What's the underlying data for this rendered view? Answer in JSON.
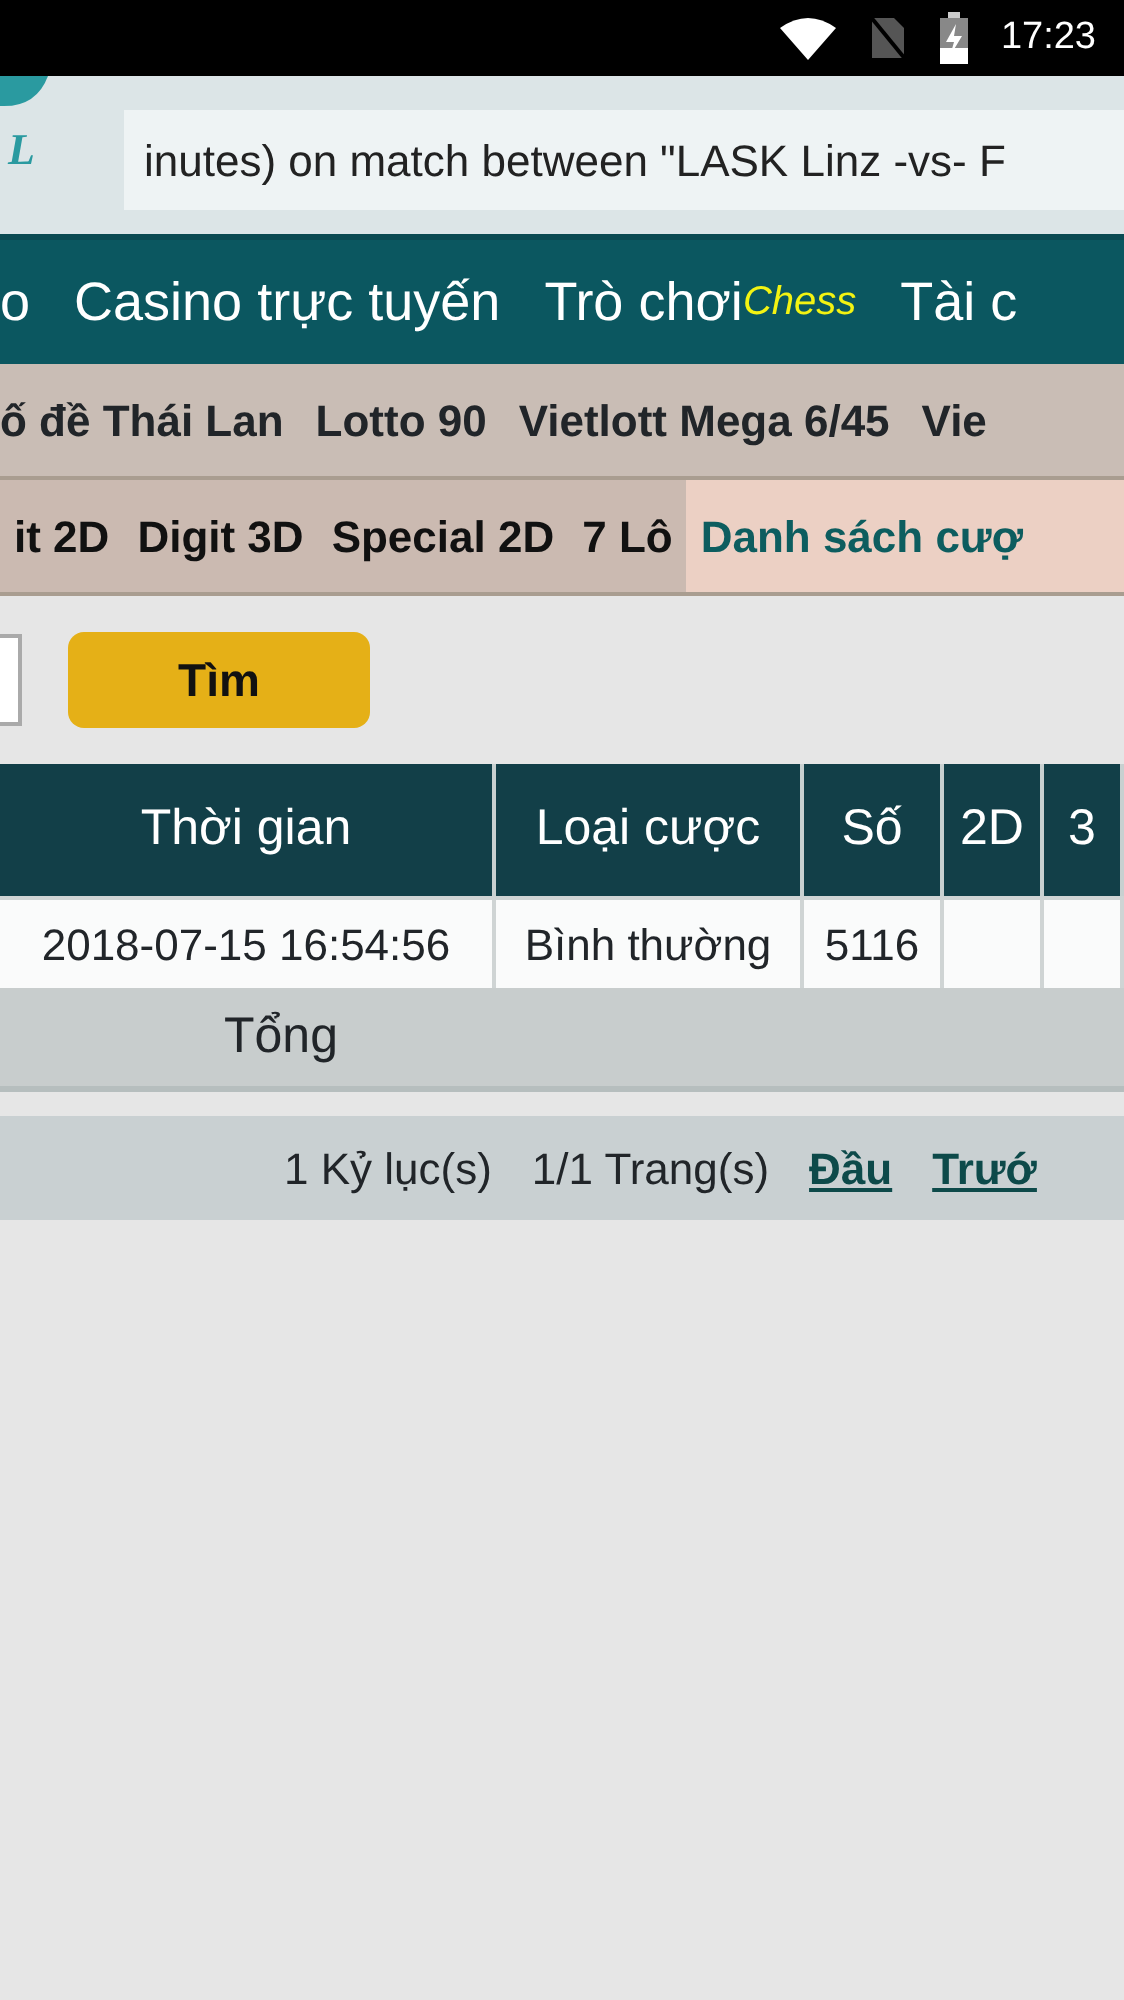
{
  "status_bar": {
    "time": "17:23"
  },
  "header": {
    "logo_text": "L",
    "ticker": "inutes) on match between \"LASK Linz -vs- F"
  },
  "nav": {
    "items": [
      {
        "label": "o"
      },
      {
        "label": "Casino trực tuyến"
      },
      {
        "label": "Trò chơi",
        "superscript": "Chess"
      },
      {
        "label": "Tài c"
      }
    ]
  },
  "lottery_menu": {
    "items": [
      "ố đề Thái Lan",
      "Lotto 90",
      "Vietlott Mega 6/45",
      "Vie"
    ]
  },
  "game_tabs": [
    {
      "label": "it 2D",
      "selected": false
    },
    {
      "label": "Digit 3D",
      "selected": false
    },
    {
      "label": "Special 2D",
      "selected": false
    },
    {
      "label": "7 Lô",
      "selected": false
    },
    {
      "label": "Danh sách cượ",
      "selected": true
    }
  ],
  "search": {
    "button": "Tìm"
  },
  "table": {
    "columns": [
      "Thời gian",
      "Loại cược",
      "Số",
      "2D",
      "3"
    ],
    "rows": [
      [
        "2018-07-15 16:54:56",
        "Bình thường",
        "5116"
      ]
    ],
    "total_label": "Tổng"
  },
  "pagination": {
    "records": "1 Kỷ lục(s)",
    "pages": "1/1 Trang(s)",
    "links": [
      "Đầu",
      "Trướ"
    ]
  }
}
